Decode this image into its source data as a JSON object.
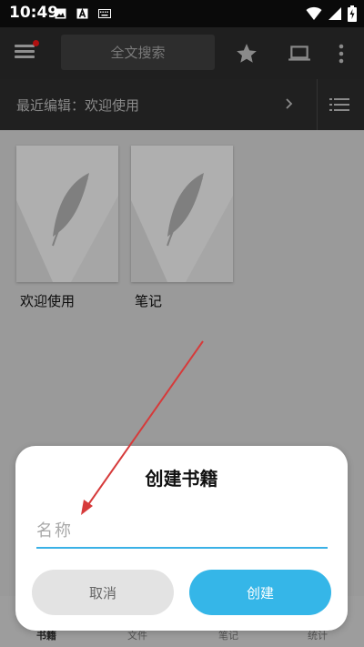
{
  "status_bar": {
    "time": "10:49",
    "left_icons": [
      "image-icon",
      "a-icon",
      "keyboard-icon"
    ],
    "right_icons": [
      "wifi-icon",
      "signal-icon",
      "battery-charging-icon"
    ]
  },
  "toolbar": {
    "search_placeholder": "全文搜索",
    "icons": [
      "menu-icon",
      "star-icon",
      "laptop-icon",
      "more-vert-icon"
    ]
  },
  "recent": {
    "label": "最近编辑：欢迎使用"
  },
  "books": [
    {
      "title": "欢迎使用"
    },
    {
      "title": "笔记"
    }
  ],
  "bottom_nav": {
    "items": [
      "书籍",
      "文件",
      "笔记",
      "统计"
    ]
  },
  "dialog": {
    "title": "创建书籍",
    "input_placeholder": "名称",
    "input_value": "",
    "cancel_label": "取消",
    "create_label": "创建"
  },
  "colors": {
    "accent": "#35b6e8",
    "toolbar_bg": "#1f1f1f",
    "annotation_arrow": "#d63a3a"
  }
}
